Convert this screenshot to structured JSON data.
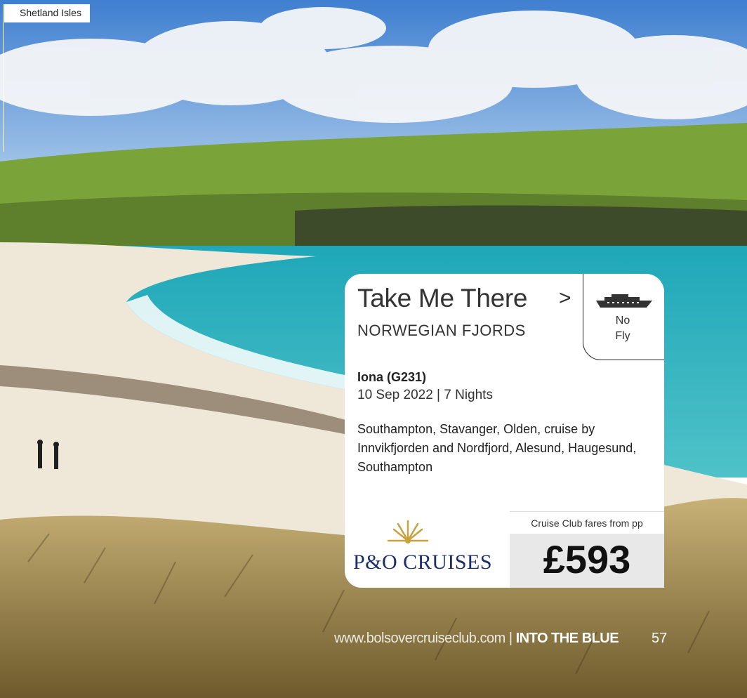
{
  "caption": "Shetland Isles",
  "card": {
    "title": "Take Me There",
    "arrow": ">",
    "destination": "NORWEGIAN FJORDS",
    "badge": {
      "line1": "No",
      "line2": "Fly",
      "icon": "ship-icon"
    },
    "ship": "Iona (G231)",
    "dates": "10 Sep 2022 | 7 Nights",
    "itinerary": "Southampton, Stavanger, Olden, cruise by Innvikfjorden and Nordfjord, Alesund, Haugesund, Southampton",
    "brand": "P&O CRUISES",
    "price_label": "Cruise Club fares from pp",
    "price": "£593"
  },
  "footer": {
    "url": "www.bolsovercruiseclub.com",
    "separator": "|",
    "section": "INTO THE BLUE",
    "page": "57"
  },
  "colors": {
    "brand_navy": "#1b2e6a",
    "sea": "#2fb3c0",
    "sand": "#efe7d8",
    "grass": "#7aa43a"
  }
}
